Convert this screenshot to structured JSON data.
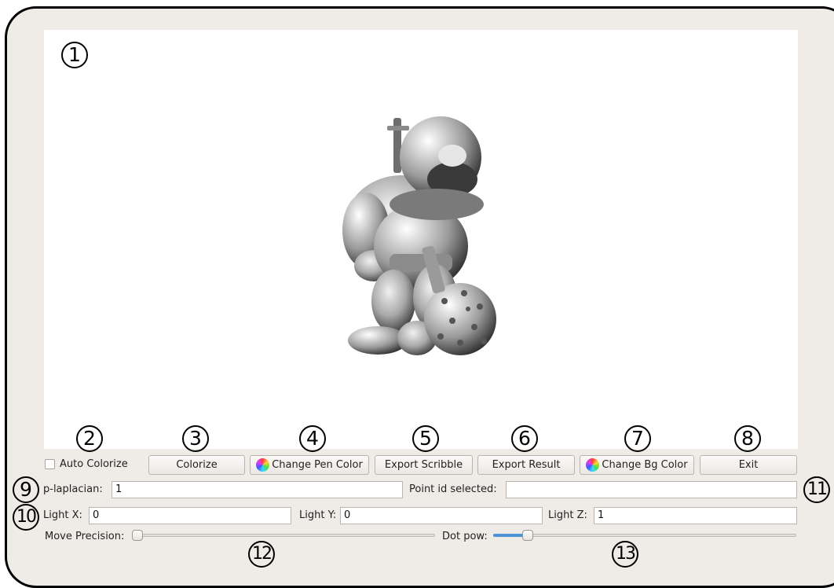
{
  "callouts": [
    "1",
    "2",
    "3",
    "4",
    "5",
    "6",
    "7",
    "8",
    "9",
    "10",
    "11",
    "12",
    "13"
  ],
  "controls": {
    "auto_colorize_label": "Auto Colorize",
    "auto_colorize_checked": false,
    "colorize_label": "Colorize",
    "change_pen_color_label": "Change Pen Color",
    "export_scribble_label": "Export Scribble",
    "export_result_label": "Export Result",
    "change_bg_color_label": "Change Bg Color",
    "exit_label": "Exit"
  },
  "fields": {
    "p_laplacian_label": "p-laplacian:",
    "p_laplacian_value": "1",
    "point_id_label": "Point id selected:",
    "point_id_value": "",
    "light_x_label": "Light X:",
    "light_x_value": "0",
    "light_y_label": "Light Y:",
    "light_y_value": "0",
    "light_z_label": "Light Z:",
    "light_z_value": "1"
  },
  "sliders": {
    "move_precision_label": "Move Precision:",
    "move_precision_level": 0.0,
    "dot_pow_label": "Dot pow:",
    "dot_pow_level": 0.1
  },
  "colors": {
    "accent": "#4b93d6",
    "panel": "#efebe7",
    "viewport_bg": "#ffffff"
  },
  "icons": [
    "color-wheel-icon"
  ]
}
